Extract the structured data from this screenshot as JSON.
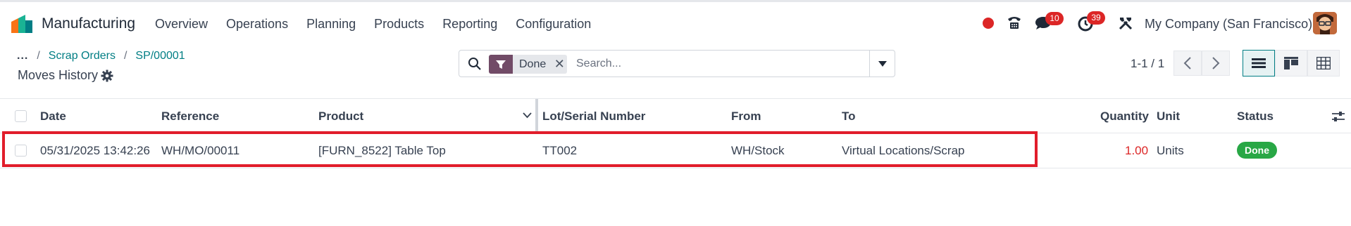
{
  "navbar": {
    "app_name": "Manufacturing",
    "menu": [
      "Overview",
      "Operations",
      "Planning",
      "Products",
      "Reporting",
      "Configuration"
    ],
    "chat_badge": "10",
    "activity_badge": "39",
    "company": "My Company (San Francisco)"
  },
  "control_panel": {
    "breadcrumb": [
      "...",
      "Scrap Orders",
      "SP/00001"
    ],
    "title": "Moves History",
    "search": {
      "facet": "Done",
      "placeholder": "Search..."
    },
    "pager": "1-1 / 1"
  },
  "table": {
    "columns": [
      "Date",
      "Reference",
      "Product",
      "Lot/Serial Number",
      "From",
      "To",
      "Quantity",
      "Unit",
      "Status"
    ],
    "rows": [
      {
        "date": "05/31/2025 13:42:26",
        "reference": "WH/MO/00011",
        "product": "[FURN_8522] Table Top",
        "lot": "TT002",
        "from": "WH/Stock",
        "to": "Virtual Locations/Scrap",
        "quantity": "1.00",
        "unit": "Units",
        "status": "Done"
      }
    ]
  },
  "colors": {
    "accent": "#017e84",
    "brand": "#714b67",
    "danger": "#dc2626",
    "done": "#28a745"
  }
}
